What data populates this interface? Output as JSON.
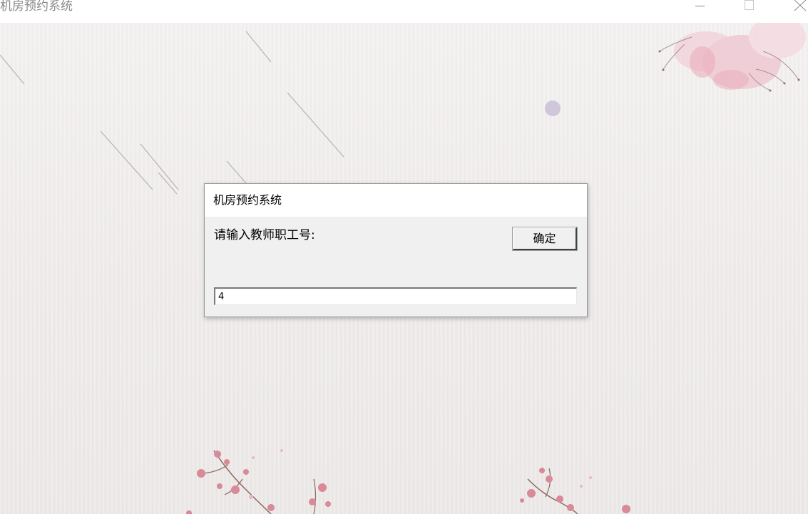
{
  "window": {
    "title": "机房预约系统",
    "controls": {
      "minimize_icon": "minimize-icon",
      "maximize_icon": "maximize-icon",
      "close_icon": "close-icon"
    }
  },
  "dialog": {
    "title": "机房预约系统",
    "prompt": "请输入教师职工号:",
    "ok_label": "确定",
    "input_value": "4"
  },
  "colors": {
    "background": "#f1eeee",
    "petal_pink": "#e8a3b4",
    "dot_purple": "#c9bfd6",
    "dialog_bg": "#f0f0f0"
  }
}
